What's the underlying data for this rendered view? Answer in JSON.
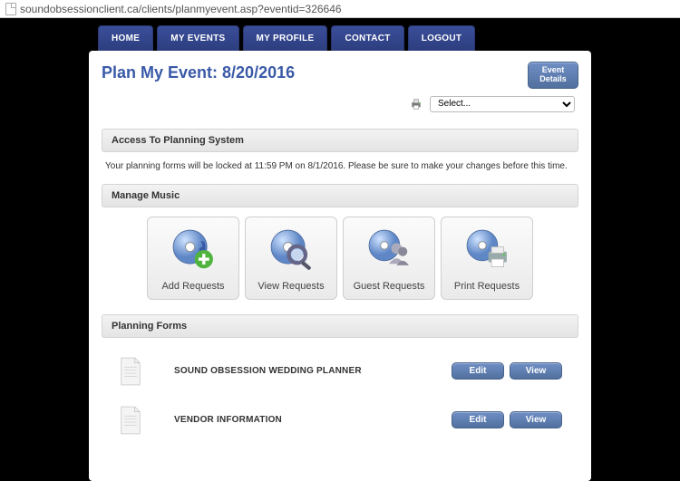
{
  "url": "soundobsessionclient.ca/clients/planmyevent.asp?eventid=326646",
  "nav": {
    "home": "HOME",
    "my_events": "MY EVENTS",
    "my_profile": "MY PROFILE",
    "contact": "CONTACT",
    "logout": "LOGOUT"
  },
  "page_title": "Plan My Event: 8/20/2016",
  "event_details_btn": "Event\nDetails",
  "print_select_placeholder": "Select...",
  "sections": {
    "access": {
      "heading": "Access To Planning System",
      "notice": "Your planning forms will be locked at 11:59 PM on 8/1/2016. Please be sure to make your changes before this time."
    },
    "music": {
      "heading": "Manage Music",
      "cards": {
        "add": "Add Requests",
        "view": "View Requests",
        "guest": "Guest Requests",
        "print": "Print Requests"
      }
    },
    "forms": {
      "heading": "Planning Forms",
      "items": [
        {
          "name": "SOUND OBSESSION WEDDING PLANNER"
        },
        {
          "name": "VENDOR INFORMATION"
        }
      ],
      "edit_label": "Edit",
      "view_label": "View"
    }
  }
}
